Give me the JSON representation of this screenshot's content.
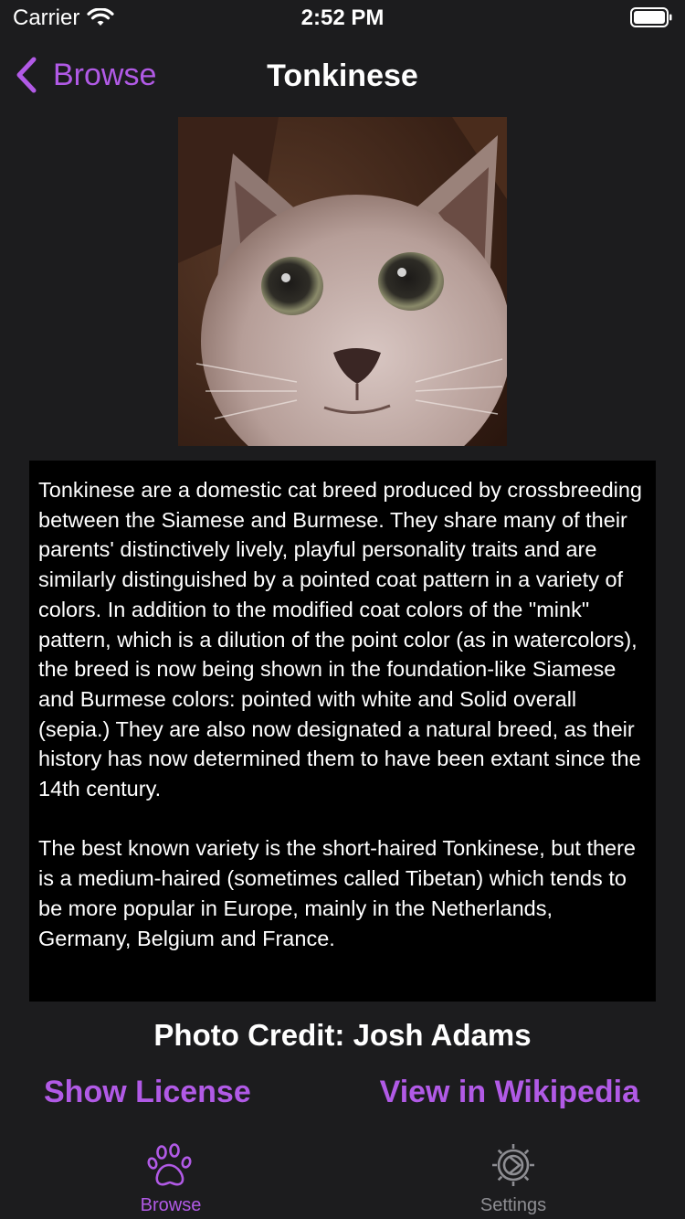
{
  "status_bar": {
    "carrier": "Carrier",
    "time": "2:52 PM",
    "icons": [
      "wifi-icon",
      "battery-icon"
    ]
  },
  "nav": {
    "back_label": "Browse",
    "title": "Tonkinese",
    "back_icon": "chevron-left-icon"
  },
  "photo": {
    "subject": "cat-photo"
  },
  "description": {
    "paragraphs": [
      "Tonkinese are a domestic cat breed produced by crossbreeding between the Siamese and Burmese. They share many of their parents' distinctively lively, playful personality traits and are similarly distinguished by a pointed coat pattern in a variety of colors. In addition to the modified coat colors of the \"mink\" pattern, which is a dilution of the point color (as in watercolors), the breed is now being shown in the foundation-like Siamese and Burmese colors: pointed with white and Solid overall (sepia.) They are also now designated a natural breed, as their history has now determined them to have been extant since the 14th century.",
      "The best known variety is the short-haired Tonkinese, but there is a medium-haired (sometimes called Tibetan) which tends to be more popular in Europe, mainly in the Netherlands, Germany, Belgium and France."
    ]
  },
  "credit": "Photo Credit: Josh Adams",
  "links": {
    "license": "Show License",
    "wikipedia": "View in Wikipedia"
  },
  "tabs": [
    {
      "label": "Browse",
      "icon": "paw-icon",
      "selected": true
    },
    {
      "label": "Settings",
      "icon": "gear-icon",
      "selected": false
    }
  ],
  "colors": {
    "accent": "#b15ae6",
    "background": "#1c1c1e",
    "text_box": "#000000",
    "inactive_tab": "#8e8e93"
  }
}
